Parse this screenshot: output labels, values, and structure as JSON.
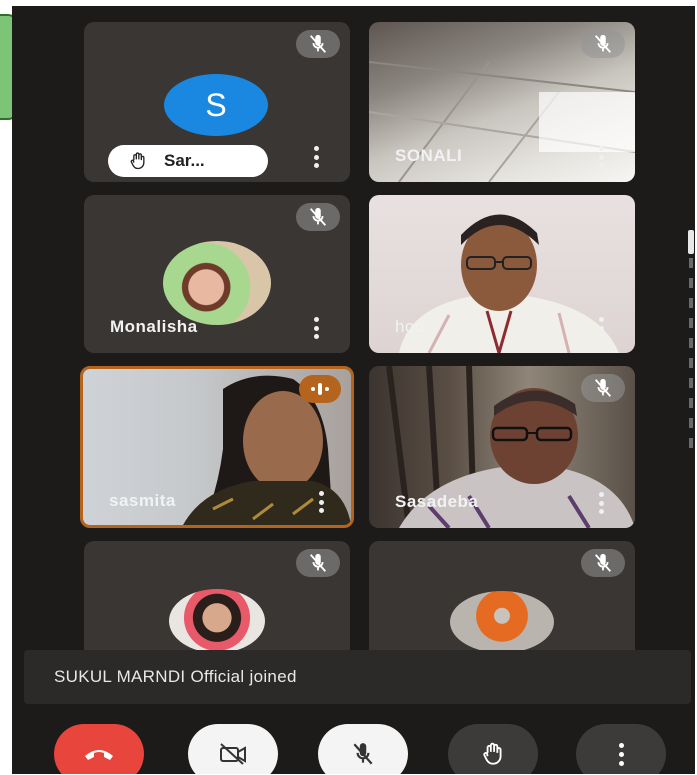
{
  "participants": [
    {
      "name": "Sar...",
      "avatar_letter": "S",
      "avatar_color": "#1a88e0",
      "hand_raised": true,
      "muted": true
    },
    {
      "name": "SONALI",
      "muted": true
    },
    {
      "name": "Monalisha",
      "muted": true
    },
    {
      "name": "hod",
      "muted": false
    },
    {
      "name": "sasmita",
      "muted": false,
      "speaking": true,
      "highlight_color": "#b5641e"
    },
    {
      "name": "Sasadeba",
      "muted": true
    },
    {
      "name": "",
      "muted": true
    },
    {
      "name": "",
      "muted": true
    }
  ],
  "notification": {
    "text": "SUKUL MARNDI Official joined"
  },
  "controls": {
    "end_call": {
      "icon": "phone-hangup-icon",
      "color": "#e8453c"
    },
    "camera": {
      "icon": "camera-off-icon"
    },
    "microphone": {
      "icon": "mic-off-icon"
    },
    "raise_hand": {
      "icon": "hand-icon"
    },
    "more": {
      "icon": "more-vert-icon"
    }
  }
}
